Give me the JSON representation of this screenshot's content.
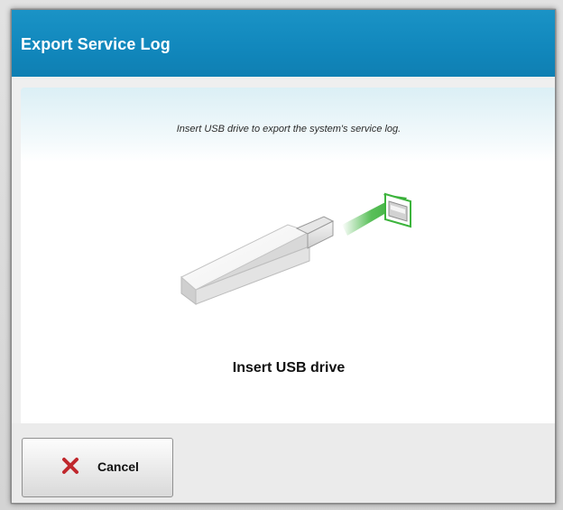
{
  "dialog": {
    "title": "Export Service Log"
  },
  "content": {
    "instruction": "Insert USB drive to export the system's service log.",
    "illustration_icon": "usb-drive-insert-icon",
    "status_label": "Insert USB drive"
  },
  "footer": {
    "cancel_label": "Cancel",
    "cancel_icon": "close-icon"
  },
  "colors": {
    "titlebar": "#1187bc",
    "arrow": "#3cb43c",
    "cancel_icon": "#c0282d"
  }
}
